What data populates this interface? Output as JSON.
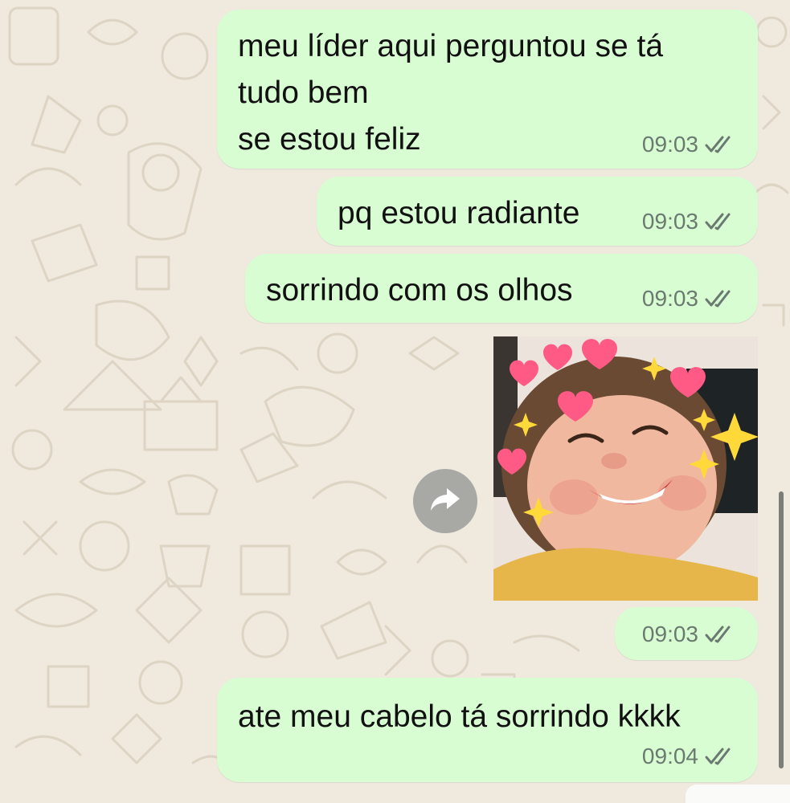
{
  "chat": {
    "messages": [
      {
        "text": "meu líder aqui perguntou se tá\ntudo bem\nse estou feliz",
        "time": "09:03",
        "status": "read"
      },
      {
        "text": "pq estou radiante",
        "time": "09:03",
        "status": "read"
      },
      {
        "text": "sorrindo com os olhos",
        "time": "09:03",
        "status": "read"
      },
      {
        "type": "image",
        "description_icon": "sticker-image",
        "time": "09:03",
        "status": "read"
      },
      {
        "text": "ate meu cabelo tá sorrindo kkkk",
        "time": "09:04",
        "status": "read"
      }
    ]
  },
  "colors": {
    "outgoing_bubble": "#d9fdd3",
    "wallpaper": "#efe9de",
    "meta_text": "#6b7a70"
  },
  "icons": {
    "read_ticks": "double-check-icon",
    "forward": "forward-arrow-icon"
  }
}
